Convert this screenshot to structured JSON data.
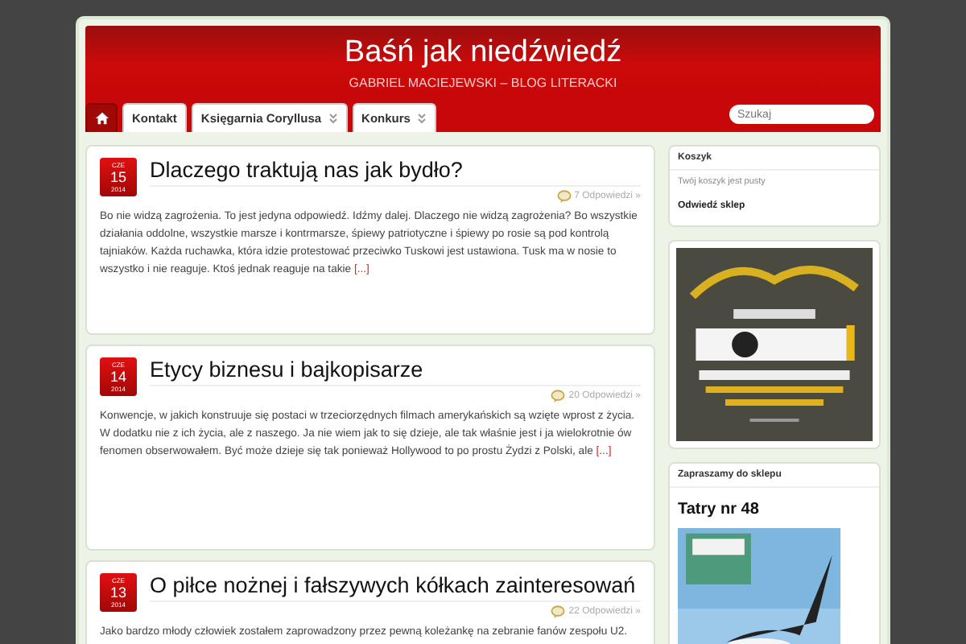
{
  "header": {
    "title": "Baśń jak niedźwiedź",
    "tagline": "GABRIEL MACIEJEWSKI – BLOG LITERACKI"
  },
  "nav": {
    "items": [
      {
        "kind": "home",
        "selected": true
      },
      {
        "kind": "text",
        "label": "Kontakt",
        "has_submenu": false,
        "selected": false
      },
      {
        "kind": "text",
        "label": "Księgarnia Coryllusa",
        "has_submenu": true,
        "selected": false
      },
      {
        "kind": "text",
        "label": "Konkurs",
        "has_submenu": true,
        "selected": false
      }
    ],
    "search": {
      "placeholder": "Szukaj"
    }
  },
  "posts": [
    {
      "month": "CZE",
      "day": "15",
      "year": "2014",
      "title": "Dlaczego traktują nas jak bydło?",
      "comments": "7 Odpowiedzi »",
      "excerpt": "Bo nie widzą zagrożenia. To jest jedyna odpowiedź. Idźmy dalej. Dlaczego nie widzą zagrożenia? Bo wszystkie działania oddolne, wszystkie marsze i kontrmarsze, śpiewy patriotyczne i śpiewy po rosie są pod kontrolą tajniaków. Każda ruchawka, która idzie protestować przeciwko Tuskowi jest ustawiona. Tusk ma w nosie to wszystko i nie reaguje. Ktoś jednak reaguje na takie",
      "more": "[...]"
    },
    {
      "month": "CZE",
      "day": "14",
      "year": "2014",
      "title": "Etycy biznesu i bajkopisarze",
      "comments": "20 Odpowiedzi »",
      "excerpt": "Konwencje, w jakich konstruuje się postaci w trzeciorzędnych filmach amerykańskich są wzięte wprost z życia. W dodatku nie z ich życia, ale z naszego. Ja nie wiem jak to się dzieje, ale tak właśnie jest i ja wielokrotnie ów fenomen obserwowałem. Być może dzieje się tak ponieważ Hollywood to po prostu Żydzi z Polski, ale",
      "more": "[...]"
    },
    {
      "month": "CZE",
      "day": "13",
      "year": "2014",
      "title": "O piłce nożnej i fałszywych kółkach zainteresowań",
      "comments": "22 Odpowiedzi »",
      "excerpt": "Jako bardzo młody człowiek zostałem zaprowadzony przez pewną koleżankę na zebranie fanów zespołu U2."
    }
  ],
  "sidebar": [
    {
      "kind": "cart",
      "title": "Koszyk",
      "empty_text": "Twój koszyk jest pusty",
      "link": "Odwiedź sklep"
    },
    {
      "kind": "banner"
    },
    {
      "kind": "shop",
      "title": "Zapraszamy do sklepu",
      "product": "Tatry nr 48"
    }
  ]
}
